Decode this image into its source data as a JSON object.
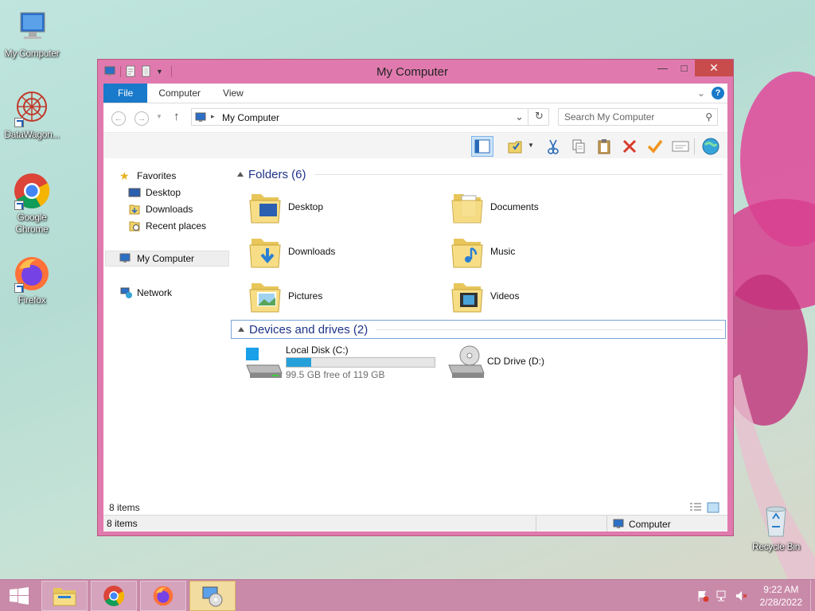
{
  "desktop": {
    "icons": [
      {
        "label": "My Computer"
      },
      {
        "label": "DataWagon..."
      },
      {
        "label": "Google Chrome"
      },
      {
        "label": "Firefox"
      },
      {
        "label": "Recycle Bin"
      }
    ]
  },
  "window": {
    "title": "My Computer",
    "ribbon_tabs": [
      "File",
      "Computer",
      "View"
    ],
    "address": "My Computer",
    "search_placeholder": "Search My Computer",
    "nav": {
      "favorites": "Favorites",
      "desktop": "Desktop",
      "downloads": "Downloads",
      "recent": "Recent places",
      "my_computer": "My Computer",
      "network": "Network"
    },
    "folders_group": "Folders (6)",
    "folders": [
      "Desktop",
      "Documents",
      "Downloads",
      "Music",
      "Pictures",
      "Videos"
    ],
    "devices_group": "Devices and drives (2)",
    "drives": [
      {
        "name": "Local Disk (C:)",
        "free_text": "99.5 GB free of 119 GB",
        "used_fraction": 0.164
      },
      {
        "name": "CD Drive (D:)"
      }
    ],
    "items_count": "8 items",
    "status_left": "8 items",
    "status_right": "Computer"
  },
  "taskbar": {
    "time": "9:22 AM",
    "date": "2/28/2022"
  },
  "colors": {
    "window_frame": "#e07aae",
    "accent": "#1979ca",
    "taskbar": "#c98aa9",
    "progress_fill": "#26a0da"
  }
}
